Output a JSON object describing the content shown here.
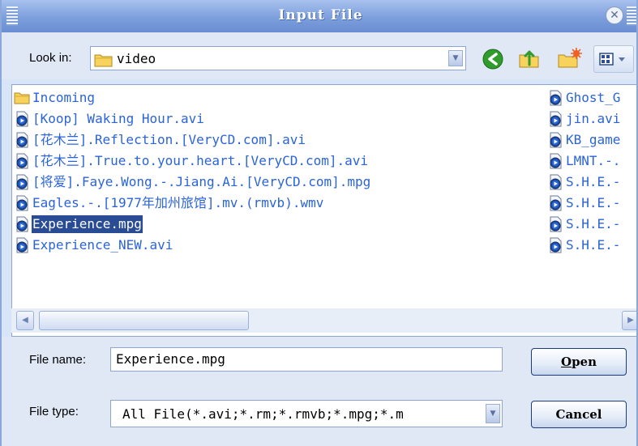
{
  "window": {
    "title": "Input File",
    "close_glyph": "✕"
  },
  "lookin": {
    "label": "Look in:",
    "value": "video",
    "icon": "folder-icon"
  },
  "toolbar": {
    "buttons": [
      {
        "name": "back-button",
        "icon": "back-arrow-icon"
      },
      {
        "name": "up-folder-button",
        "icon": "up-folder-icon"
      },
      {
        "name": "new-folder-button",
        "icon": "new-folder-icon"
      },
      {
        "name": "view-menu-button",
        "icon": "view-menu-icon"
      }
    ]
  },
  "files": {
    "left_column": [
      {
        "name": "Incoming",
        "type": "folder"
      },
      {
        "name": "[Koop] Waking Hour.avi",
        "type": "video"
      },
      {
        "name": "[花木兰].Reflection.[VeryCD.com].avi",
        "type": "video"
      },
      {
        "name": "[花木兰].True.to.your.heart.[VeryCD.com].avi",
        "type": "video"
      },
      {
        "name": "[将爱].Faye.Wong.-.Jiang.Ai.[VeryCD.com].mpg",
        "type": "video"
      },
      {
        "name": "Eagles.-.[1977年加州旅馆].mv.(rmvb).wmv",
        "type": "video"
      },
      {
        "name": "Experience.mpg",
        "type": "video",
        "selected": true
      },
      {
        "name": "Experience_NEW.avi",
        "type": "video"
      }
    ],
    "right_column": [
      {
        "name": "Ghost_G",
        "type": "video"
      },
      {
        "name": "jin.avi",
        "type": "video"
      },
      {
        "name": "KB_game",
        "type": "video"
      },
      {
        "name": "LMNT.-.",
        "type": "video"
      },
      {
        "name": "S.H.E.-",
        "type": "video"
      },
      {
        "name": "S.H.E.-",
        "type": "video"
      },
      {
        "name": "S.H.E.-",
        "type": "video"
      },
      {
        "name": "S.H.E.-",
        "type": "video"
      }
    ]
  },
  "scrollbar": {
    "left_glyph": "◀",
    "right_glyph": "▶",
    "position_fraction": 0.0,
    "visible_fraction": 0.36
  },
  "form": {
    "filename_label": "File name:",
    "filename_value": "Experience.mpg",
    "filetype_label": "File type:",
    "filetype_value": "All File(*.avi;*.rm;*.rmvb;*.mpg;*.m",
    "open_mnemonic": "O",
    "open_rest": "pen",
    "cancel_label": "Cancel"
  },
  "colors": {
    "title_bar": "#7c9edc",
    "dialog_bg": "#e0e8f6",
    "selection": "#2a4c94",
    "file_text": "#2a64d8"
  }
}
